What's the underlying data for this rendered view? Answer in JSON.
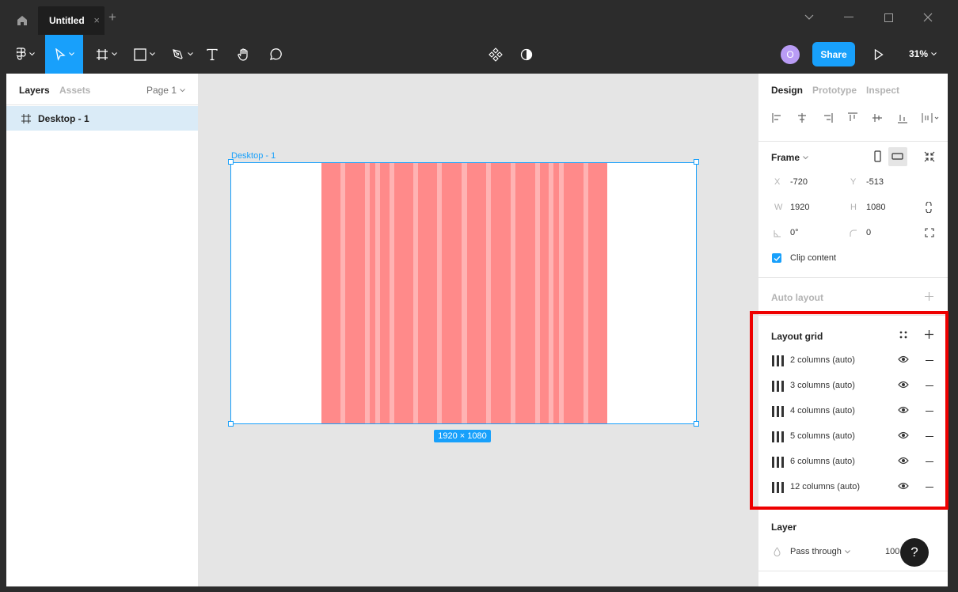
{
  "titlebar": {
    "tab_title": "Untitled",
    "tab_close": "×",
    "new_tab": "+"
  },
  "toolbar": {
    "avatar_initial": "O",
    "share_label": "Share",
    "zoom": "31%"
  },
  "left_panel": {
    "tabs": [
      "Layers",
      "Assets"
    ],
    "page": "Page 1",
    "layers": [
      {
        "name": "Desktop - 1",
        "icon": "frame-hash-icon"
      }
    ]
  },
  "canvas": {
    "frame_label": "Desktop - 1",
    "dimensions": "1920 × 1080",
    "grid_color": "#ff8a8a"
  },
  "right_panel": {
    "tabs": [
      "Design",
      "Prototype",
      "Inspect"
    ],
    "frame": {
      "title": "Frame",
      "x_label": "X",
      "x": "-720",
      "y_label": "Y",
      "y": "-513",
      "w_label": "W",
      "w": "1920",
      "h_label": "H",
      "h": "1080",
      "rotation": "0°",
      "radius": "0",
      "clip_content": "Clip content",
      "clip_checked": true
    },
    "auto_layout": "Auto layout",
    "layout_grid": {
      "title": "Layout grid",
      "grids": [
        {
          "label": "2 columns (auto)"
        },
        {
          "label": "3 columns (auto)"
        },
        {
          "label": "4 columns (auto)"
        },
        {
          "label": "5 columns (auto)"
        },
        {
          "label": "6 columns (auto)"
        },
        {
          "label": "12 columns (auto)"
        }
      ]
    },
    "layer": {
      "title": "Layer",
      "blend": "Pass through",
      "opacity": "100"
    }
  },
  "help": "?",
  "colors": {
    "accent": "#18a0fb",
    "highlight": "#ee0000",
    "selected_row": "#daebf7"
  }
}
